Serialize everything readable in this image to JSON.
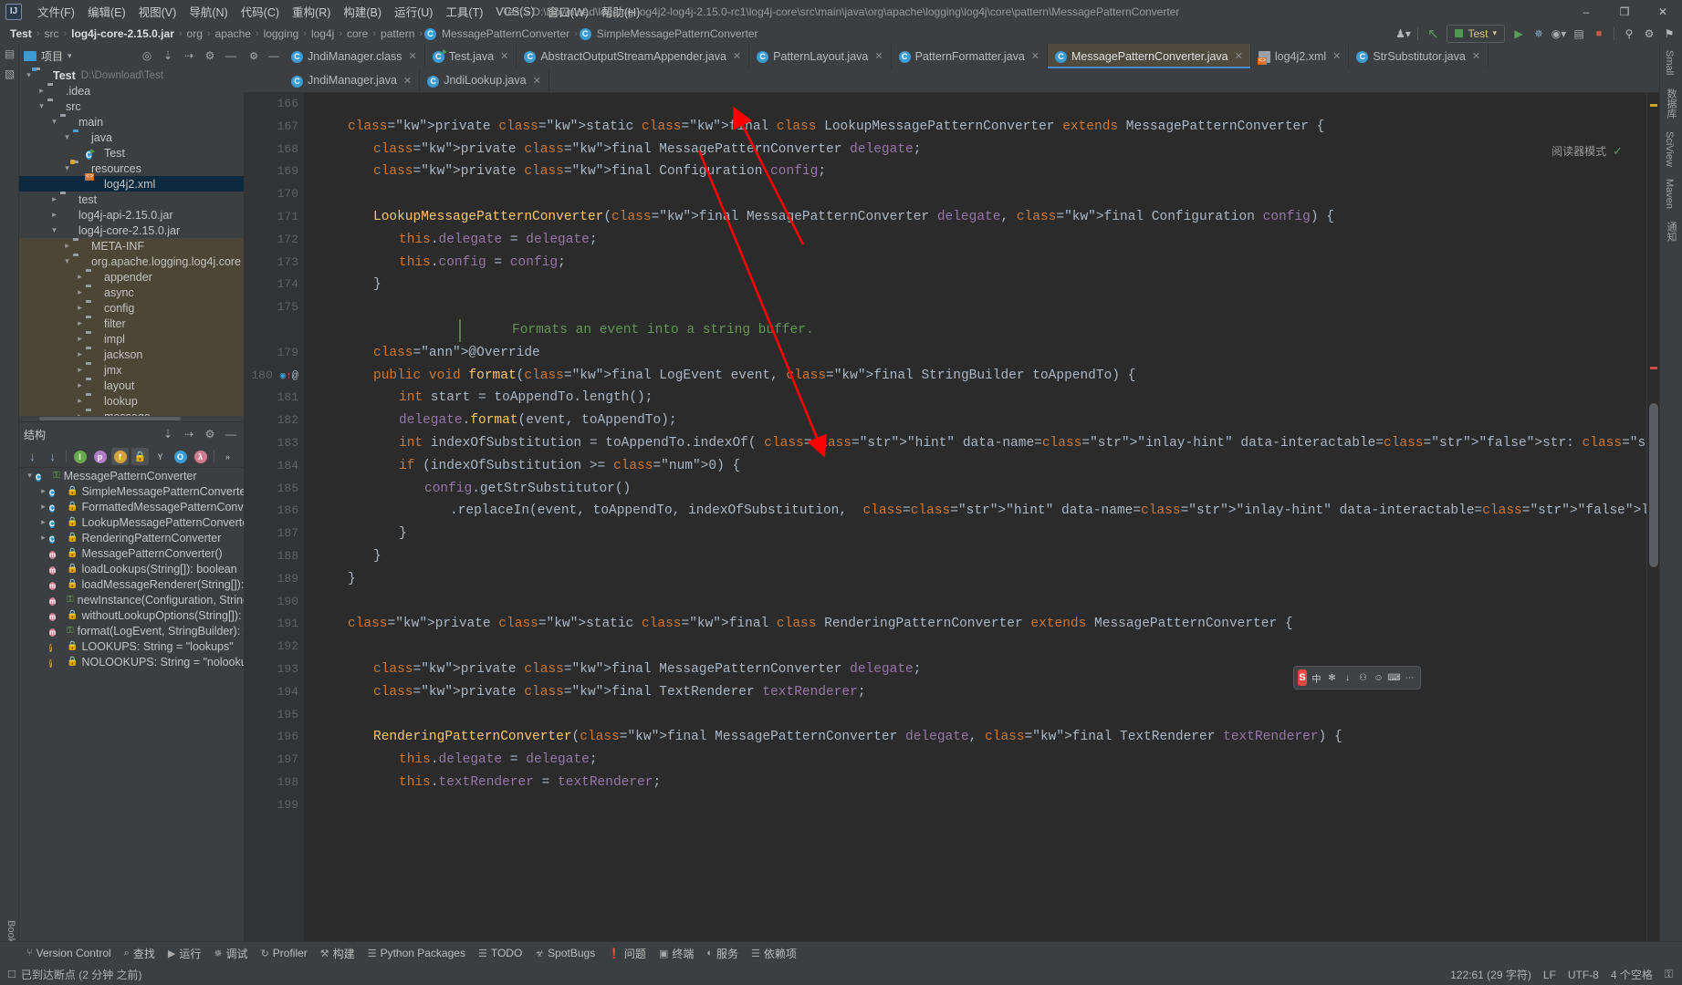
{
  "window": {
    "title": "Test - D:\\Download\\logging-log4j2-log4j-2.15.0-rc1\\log4j-core\\src\\main\\java\\org\\apache\\logging\\log4j\\core\\pattern\\MessagePatternConverter",
    "logo": "IJ",
    "minimize": "–",
    "maximize": "❐",
    "close": "✕"
  },
  "menubar": {
    "items": [
      {
        "label": "文件(F)",
        "name": "menu-file"
      },
      {
        "label": "编辑(E)",
        "name": "menu-edit"
      },
      {
        "label": "视图(V)",
        "name": "menu-view"
      },
      {
        "label": "导航(N)",
        "name": "menu-navigate"
      },
      {
        "label": "代码(C)",
        "name": "menu-code"
      },
      {
        "label": "重构(R)",
        "name": "menu-refactor"
      },
      {
        "label": "构建(B)",
        "name": "menu-build"
      },
      {
        "label": "运行(U)",
        "name": "menu-run"
      },
      {
        "label": "工具(T)",
        "name": "menu-tools"
      },
      {
        "label": "VCS(S)",
        "name": "menu-vcs"
      },
      {
        "label": "窗口(W)",
        "name": "menu-window"
      },
      {
        "label": "帮助(H)",
        "name": "menu-help"
      }
    ]
  },
  "breadcrumb": {
    "items": [
      {
        "label": "Test",
        "bold": true
      },
      {
        "label": "src",
        "bold": false
      },
      {
        "label": "log4j-core-2.15.0.jar",
        "bold": true
      },
      {
        "label": "org",
        "bold": false
      },
      {
        "label": "apache",
        "bold": false
      },
      {
        "label": "logging",
        "bold": false
      },
      {
        "label": "log4j",
        "bold": false
      },
      {
        "label": "core",
        "bold": false
      },
      {
        "label": "pattern",
        "bold": false
      },
      {
        "label": "MessagePatternConverter",
        "bold": false,
        "icon": "class-icon"
      },
      {
        "label": "SimpleMessagePatternConverter",
        "bold": false,
        "icon": "class-icon"
      }
    ],
    "separator": "›"
  },
  "toolbar": {
    "run_config": "Test",
    "icons": [
      {
        "name": "user-settings-icon",
        "glyph": "♟"
      },
      {
        "name": "updates-icon",
        "glyph": "↖"
      },
      {
        "name": "run-icon",
        "glyph": "▶"
      },
      {
        "name": "debug-icon",
        "glyph": "✵"
      },
      {
        "name": "coverage-icon",
        "glyph": "☉"
      },
      {
        "name": "profiler-icon",
        "glyph": "☷"
      },
      {
        "name": "stop-icon",
        "glyph": "■"
      },
      {
        "name": "search-everywhere-icon",
        "glyph": "⌕"
      },
      {
        "name": "settings-icon",
        "glyph": "⚙"
      },
      {
        "name": "notifications-icon",
        "glyph": "⚑"
      }
    ]
  },
  "left_strip": {
    "items": [
      {
        "label": "Bookmarks",
        "name": "strip-bookmarks"
      }
    ],
    "icons": [
      {
        "name": "project-structure-icon",
        "glyph": "▤"
      },
      {
        "name": "folder-icon",
        "glyph": "▣"
      }
    ]
  },
  "project_panel": {
    "title": "项目",
    "dropdown": "▾",
    "header_icons": [
      {
        "name": "locate-icon",
        "glyph": "⌖"
      },
      {
        "name": "expand-all-icon",
        "glyph": "⤓"
      },
      {
        "name": "collapse-all-icon",
        "glyph": "⤒"
      },
      {
        "name": "settings-icon",
        "glyph": "⚙"
      },
      {
        "name": "hide-icon",
        "glyph": "—"
      }
    ],
    "tree": [
      {
        "label": "Test",
        "path": "D:\\Download\\Test",
        "depth": 0,
        "arrow": "v",
        "icon": "module-folder",
        "bold": true,
        "selected": false
      },
      {
        "label": ".idea",
        "path": "",
        "depth": 1,
        "arrow": ">",
        "icon": "folder",
        "bold": false,
        "selected": false
      },
      {
        "label": "src",
        "path": "",
        "depth": 1,
        "arrow": "v",
        "icon": "folder",
        "bold": false,
        "selected": false
      },
      {
        "label": "main",
        "path": "",
        "depth": 2,
        "arrow": "v",
        "icon": "folder",
        "bold": false,
        "selected": false
      },
      {
        "label": "java",
        "path": "",
        "depth": 3,
        "arrow": "v",
        "icon": "source-folder",
        "bold": false,
        "selected": false
      },
      {
        "label": "Test",
        "path": "",
        "depth": 4,
        "arrow": "",
        "icon": "runnable-class",
        "bold": false,
        "selected": false
      },
      {
        "label": "resources",
        "path": "",
        "depth": 3,
        "arrow": "v",
        "icon": "resource-folder",
        "bold": false,
        "selected": false
      },
      {
        "label": "log4j2.xml",
        "path": "",
        "depth": 4,
        "arrow": "",
        "icon": "xml-file",
        "bold": false,
        "selected": true
      },
      {
        "label": "test",
        "path": "",
        "depth": 2,
        "arrow": ">",
        "icon": "folder",
        "bold": false,
        "selected": false
      },
      {
        "label": "log4j-api-2.15.0.jar",
        "path": "",
        "depth": 2,
        "arrow": ">",
        "icon": "jar",
        "bold": false,
        "selected": false
      },
      {
        "label": "log4j-core-2.15.0.jar",
        "path": "",
        "depth": 2,
        "arrow": "v",
        "icon": "jar",
        "bold": false,
        "selected": false
      },
      {
        "label": "META-INF",
        "path": "",
        "depth": 3,
        "arrow": ">",
        "icon": "folder",
        "bold": false,
        "selected": false,
        "scope": true
      },
      {
        "label": "org.apache.logging.log4j.core",
        "path": "",
        "depth": 3,
        "arrow": "v",
        "icon": "folder",
        "bold": false,
        "selected": false,
        "scope": true
      },
      {
        "label": "appender",
        "path": "",
        "depth": 4,
        "arrow": ">",
        "icon": "folder",
        "bold": false,
        "selected": false,
        "scope": true
      },
      {
        "label": "async",
        "path": "",
        "depth": 4,
        "arrow": ">",
        "icon": "folder",
        "bold": false,
        "selected": false,
        "scope": true
      },
      {
        "label": "config",
        "path": "",
        "depth": 4,
        "arrow": ">",
        "icon": "folder",
        "bold": false,
        "selected": false,
        "scope": true
      },
      {
        "label": "filter",
        "path": "",
        "depth": 4,
        "arrow": ">",
        "icon": "folder",
        "bold": false,
        "selected": false,
        "scope": true
      },
      {
        "label": "impl",
        "path": "",
        "depth": 4,
        "arrow": ">",
        "icon": "folder",
        "bold": false,
        "selected": false,
        "scope": true
      },
      {
        "label": "jackson",
        "path": "",
        "depth": 4,
        "arrow": ">",
        "icon": "folder",
        "bold": false,
        "selected": false,
        "scope": true
      },
      {
        "label": "jmx",
        "path": "",
        "depth": 4,
        "arrow": ">",
        "icon": "folder",
        "bold": false,
        "selected": false,
        "scope": true
      },
      {
        "label": "layout",
        "path": "",
        "depth": 4,
        "arrow": ">",
        "icon": "folder",
        "bold": false,
        "selected": false,
        "scope": true
      },
      {
        "label": "lookup",
        "path": "",
        "depth": 4,
        "arrow": ">",
        "icon": "folder",
        "bold": false,
        "selected": false,
        "scope": true
      },
      {
        "label": "message",
        "path": "",
        "depth": 4,
        "arrow": ">",
        "icon": "folder",
        "bold": false,
        "selected": false,
        "scope": true
      }
    ]
  },
  "structure_panel": {
    "title": "结构",
    "header_icons": [
      {
        "name": "expand-all-icon",
        "glyph": "⤓"
      },
      {
        "name": "collapse-all-icon",
        "glyph": "⤒"
      },
      {
        "name": "settings-icon",
        "glyph": "⚙"
      },
      {
        "name": "hide-icon",
        "glyph": "—"
      }
    ],
    "toolbar_icons": [
      {
        "name": "sort-by-visibility-icon",
        "glyph": "↓",
        "color": "#8aa8c0",
        "on": false
      },
      {
        "name": "sort-alphabetically-icon",
        "glyph": "↓",
        "color": "#8aa8c0",
        "on": false
      },
      {
        "name": "show-inherited-icon",
        "glyph": "I",
        "color": "#6aa84f",
        "on": false
      },
      {
        "name": "show-properties-icon",
        "glyph": "p",
        "color": "#b07cc6",
        "on": false
      },
      {
        "name": "show-fields-icon",
        "glyph": "f",
        "color": "#d6a23c",
        "on": true
      },
      {
        "name": "show-non-public-icon",
        "glyph": "ὑ2",
        "color": "#d4893c",
        "on": true
      },
      {
        "name": "show-anonymous-icon",
        "glyph": "Y",
        "color": "#a8a8a8",
        "on": false
      },
      {
        "name": "group-icon",
        "glyph": "O",
        "color": "#3b9bd4",
        "on": false
      },
      {
        "name": "lambda-icon",
        "glyph": "λ",
        "color": "#d27b8e",
        "on": false
      },
      {
        "name": "expand-more-icon",
        "glyph": "»",
        "color": "#a8a8a8",
        "on": false
      }
    ],
    "tree": [
      {
        "label": "MessagePatternConverter",
        "depth": 0,
        "arrow": "v",
        "icon": "class",
        "lock": "green"
      },
      {
        "label": "SimpleMessagePatternConverter",
        "depth": 1,
        "arrow": ">",
        "icon": "inner-class",
        "lock": "orange"
      },
      {
        "label": "FormattedMessagePatternConverter",
        "depth": 1,
        "arrow": ">",
        "icon": "inner-class",
        "lock": "orange"
      },
      {
        "label": "LookupMessagePatternConverter",
        "depth": 1,
        "arrow": ">",
        "icon": "inner-class",
        "lock": "orange"
      },
      {
        "label": "RenderingPatternConverter",
        "depth": 1,
        "arrow": ">",
        "icon": "inner-class",
        "lock": "orange"
      },
      {
        "label": "MessagePatternConverter()",
        "depth": 1,
        "arrow": "",
        "icon": "method",
        "lock": "orange"
      },
      {
        "label": "loadLookups(String[]): boolean",
        "depth": 1,
        "arrow": "",
        "icon": "method",
        "lock": "orange"
      },
      {
        "label": "loadMessageRenderer(String[]): TextR",
        "depth": 1,
        "arrow": "",
        "icon": "method",
        "lock": "orange"
      },
      {
        "label": "newInstance(Configuration, String[]): M",
        "depth": 1,
        "arrow": "",
        "icon": "method",
        "lock": "green"
      },
      {
        "label": "withoutLookupOptions(String[]): String",
        "depth": 1,
        "arrow": "",
        "icon": "method",
        "lock": "orange"
      },
      {
        "label": "format(LogEvent, StringBuilder): void",
        "depth": 1,
        "arrow": "",
        "icon": "method",
        "lock": "green"
      },
      {
        "label": "LOOKUPS: String = \"lookups\"",
        "depth": 1,
        "arrow": "",
        "icon": "field",
        "lock": "orange"
      },
      {
        "label": "NOLOOKUPS: String = \"nolookups\"",
        "depth": 1,
        "arrow": "",
        "icon": "field",
        "lock": "orange"
      }
    ]
  },
  "editor": {
    "tabs_row1": [
      {
        "label": "JndiManager.class",
        "icon": "class-icon",
        "active": false
      },
      {
        "label": "Test.java",
        "icon": "runnable-class-icon",
        "active": false
      },
      {
        "label": "AbstractOutputStreamAppender.java",
        "icon": "abstract-class-icon",
        "active": false
      },
      {
        "label": "PatternLayout.java",
        "icon": "class-icon",
        "active": false
      },
      {
        "label": "PatternFormatter.java",
        "icon": "class-icon",
        "active": false
      },
      {
        "label": "MessagePatternConverter.java",
        "icon": "class-icon",
        "active": true
      },
      {
        "label": "log4j2.xml",
        "icon": "xml-icon",
        "active": false
      },
      {
        "label": "StrSubstitutor.java",
        "icon": "class-icon",
        "active": false
      }
    ],
    "tabs_row2": [
      {
        "label": "JndiManager.java",
        "icon": "class-icon",
        "active": false
      },
      {
        "label": "JndiLookup.java",
        "icon": "class-icon",
        "active": false
      }
    ],
    "close_glyph": "✕",
    "reader_mode": "阅读器模式",
    "reader_check": "✓",
    "lines": [
      {
        "num": "166",
        "text": "",
        "indent": 0
      },
      {
        "num": "167",
        "text": "private static final class LookupMessagePatternConverter extends MessagePatternConverter {",
        "indent": 1,
        "foldtop": true
      },
      {
        "num": "168",
        "text": "private final MessagePatternConverter delegate;",
        "indent": 2
      },
      {
        "num": "169",
        "text": "private final Configuration config;",
        "indent": 2
      },
      {
        "num": "170",
        "text": "",
        "indent": 0
      },
      {
        "num": "171",
        "text": "LookupMessagePatternConverter(final MessagePatternConverter delegate, final Configuration config) {",
        "indent": 2
      },
      {
        "num": "172",
        "text": "this.delegate = delegate;",
        "indent": 3
      },
      {
        "num": "173",
        "text": "this.config = config;",
        "indent": 3
      },
      {
        "num": "174",
        "text": "}",
        "indent": 2
      },
      {
        "num": "175",
        "text": "",
        "indent": 0
      },
      {
        "num": "",
        "text": "Formats an event into a string buffer.",
        "indent": 2,
        "doc": true
      },
      {
        "num": "179",
        "text": "@Override",
        "indent": 2
      },
      {
        "num": "180",
        "text": "public void format(final LogEvent event, final StringBuilder toAppendTo) {",
        "indent": 2,
        "marks": "breakpoint-override"
      },
      {
        "num": "181",
        "text": "int start = toAppendTo.length();",
        "indent": 3
      },
      {
        "num": "182",
        "text": "delegate.format(event, toAppendTo);",
        "indent": 3
      },
      {
        "num": "183",
        "text": "int indexOfSubstitution = toAppendTo.indexOf( str: \"${\", start);",
        "indent": 3
      },
      {
        "num": "184",
        "text": "if (indexOfSubstitution >= 0) {",
        "indent": 3
      },
      {
        "num": "185",
        "text": "config.getStrSubstitutor()",
        "indent": 4
      },
      {
        "num": "186",
        "text": ".replaceIn(event, toAppendTo, indexOfSubstitution,  length: toAppendTo.length() - indexOfSubstitution);",
        "indent": 5
      },
      {
        "num": "187",
        "text": "}",
        "indent": 3
      },
      {
        "num": "188",
        "text": "}",
        "indent": 2
      },
      {
        "num": "189",
        "text": "}",
        "indent": 1
      },
      {
        "num": "190",
        "text": "",
        "indent": 0
      },
      {
        "num": "191",
        "text": "private static final class RenderingPatternConverter extends MessagePatternConverter {",
        "indent": 1
      },
      {
        "num": "192",
        "text": "",
        "indent": 0
      },
      {
        "num": "193",
        "text": "private final MessagePatternConverter delegate;",
        "indent": 2
      },
      {
        "num": "194",
        "text": "private final TextRenderer textRenderer;",
        "indent": 2
      },
      {
        "num": "195",
        "text": "",
        "indent": 0
      },
      {
        "num": "196",
        "text": "RenderingPatternConverter(final MessagePatternConverter delegate, final TextRenderer textRenderer) {",
        "indent": 2
      },
      {
        "num": "197",
        "text": "this.delegate = delegate;",
        "indent": 3
      },
      {
        "num": "198",
        "text": "this.textRenderer = textRenderer;",
        "indent": 3
      },
      {
        "num": "199",
        "text": "",
        "indent": 0
      }
    ],
    "inlay_hints": [
      {
        "label": "str:"
      },
      {
        "label": "length:"
      }
    ]
  },
  "right_strip": {
    "items": [
      {
        "label": "Small",
        "name": "strip-small"
      },
      {
        "label": "数据库",
        "name": "strip-database"
      },
      {
        "label": "SciView",
        "name": "strip-sciview"
      },
      {
        "label": "Maven",
        "name": "strip-maven"
      },
      {
        "label": "通知",
        "name": "strip-notifications"
      }
    ]
  },
  "ime": {
    "logo": "S",
    "mode": "中",
    "icons": [
      {
        "name": "ime-mode-icon",
        "glyph": "中"
      },
      {
        "name": "ime-sun-icon",
        "glyph": "✻"
      },
      {
        "name": "ime-pin-icon",
        "glyph": "↓"
      },
      {
        "name": "ime-mic-icon",
        "glyph": "⚇"
      },
      {
        "name": "ime-emoji-icon",
        "glyph": "☺"
      },
      {
        "name": "ime-keyboard-icon",
        "glyph": "⌨"
      },
      {
        "name": "ime-more-icon",
        "glyph": "⋯"
      }
    ]
  },
  "bottom_bar": {
    "items": [
      {
        "label": "Version Control",
        "icon": "branch-icon",
        "glyph": "⑂"
      },
      {
        "label": "查找",
        "icon": "search-icon",
        "glyph": "⌕"
      },
      {
        "label": "运行",
        "icon": "run-icon",
        "glyph": "▶"
      },
      {
        "label": "调试",
        "icon": "debug-icon",
        "glyph": "✵"
      },
      {
        "label": "Profiler",
        "icon": "profiler-icon",
        "glyph": "↻"
      },
      {
        "label": "构建",
        "icon": "build-icon",
        "glyph": "⚒"
      },
      {
        "label": "Python Packages",
        "icon": "packages-icon",
        "glyph": "☰"
      },
      {
        "label": "TODO",
        "icon": "todo-icon",
        "glyph": "☰"
      },
      {
        "label": "SpotBugs",
        "icon": "bug-icon",
        "glyph": "☣"
      },
      {
        "label": "问题",
        "icon": "problems-icon",
        "glyph": "❗"
      },
      {
        "label": "终端",
        "icon": "terminal-icon",
        "glyph": "▣"
      },
      {
        "label": "服务",
        "icon": "services-icon",
        "glyph": "◐"
      },
      {
        "label": "依赖项",
        "icon": "dependencies-icon",
        "glyph": "☰"
      }
    ]
  },
  "status_bar": {
    "message": "已到达断点 (2 分钟 之前)",
    "message_icon": "breakpoint-icon",
    "caret_position": "122:61 (29 字符)",
    "line_separator": "LF",
    "encoding": "UTF-8",
    "indent": "4 个空格",
    "lock_icon": "⚿"
  },
  "colors": {
    "accent": "#4a88c7",
    "active_tab_bg": "#4e4a3e",
    "selection": "#0d293e",
    "annotation_arrow": "#ff0000",
    "editor_bg": "#2b2b2b",
    "panel_bg": "#3c3f41"
  }
}
